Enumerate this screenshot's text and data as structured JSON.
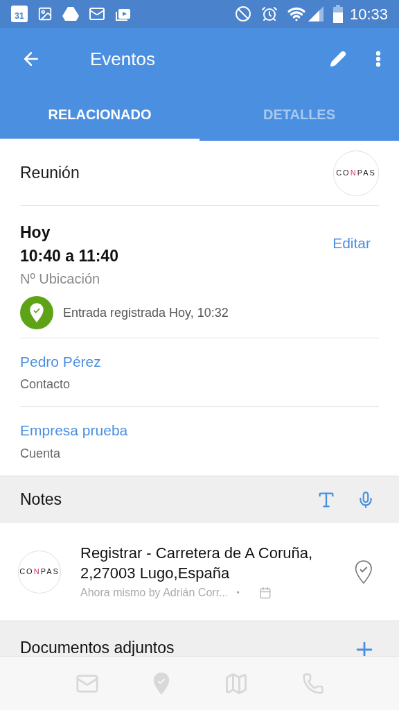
{
  "status_bar": {
    "calendar_day": "31",
    "time": "10:33"
  },
  "app_bar": {
    "title": "Eventos"
  },
  "tabs": [
    {
      "label": "RELACIONADO",
      "selected": true
    },
    {
      "label": "DETALLES",
      "selected": false
    }
  ],
  "event": {
    "type": "Reunión",
    "logo": "CONPAS",
    "day": "Hoy",
    "time_range": "10:40 a 11:40",
    "location": "Nº Ubicación",
    "edit_link": "Editar",
    "checkin": "Entrada registrada Hoy, 10:32"
  },
  "related": [
    {
      "name": "Pedro Pérez",
      "role": "Contacto"
    },
    {
      "name": "Empresa prueba",
      "role": "Cuenta"
    }
  ],
  "notes": {
    "title": "Notes",
    "items": [
      {
        "logo": "CONPAS",
        "text": "Registrar - Carretera de A Coruña, 2,27003 Lugo,España",
        "meta": "Ahora mismo by Adrián Corr...",
        "separator": "•"
      }
    ]
  },
  "attachments": {
    "title": "Documentos adjuntos"
  }
}
